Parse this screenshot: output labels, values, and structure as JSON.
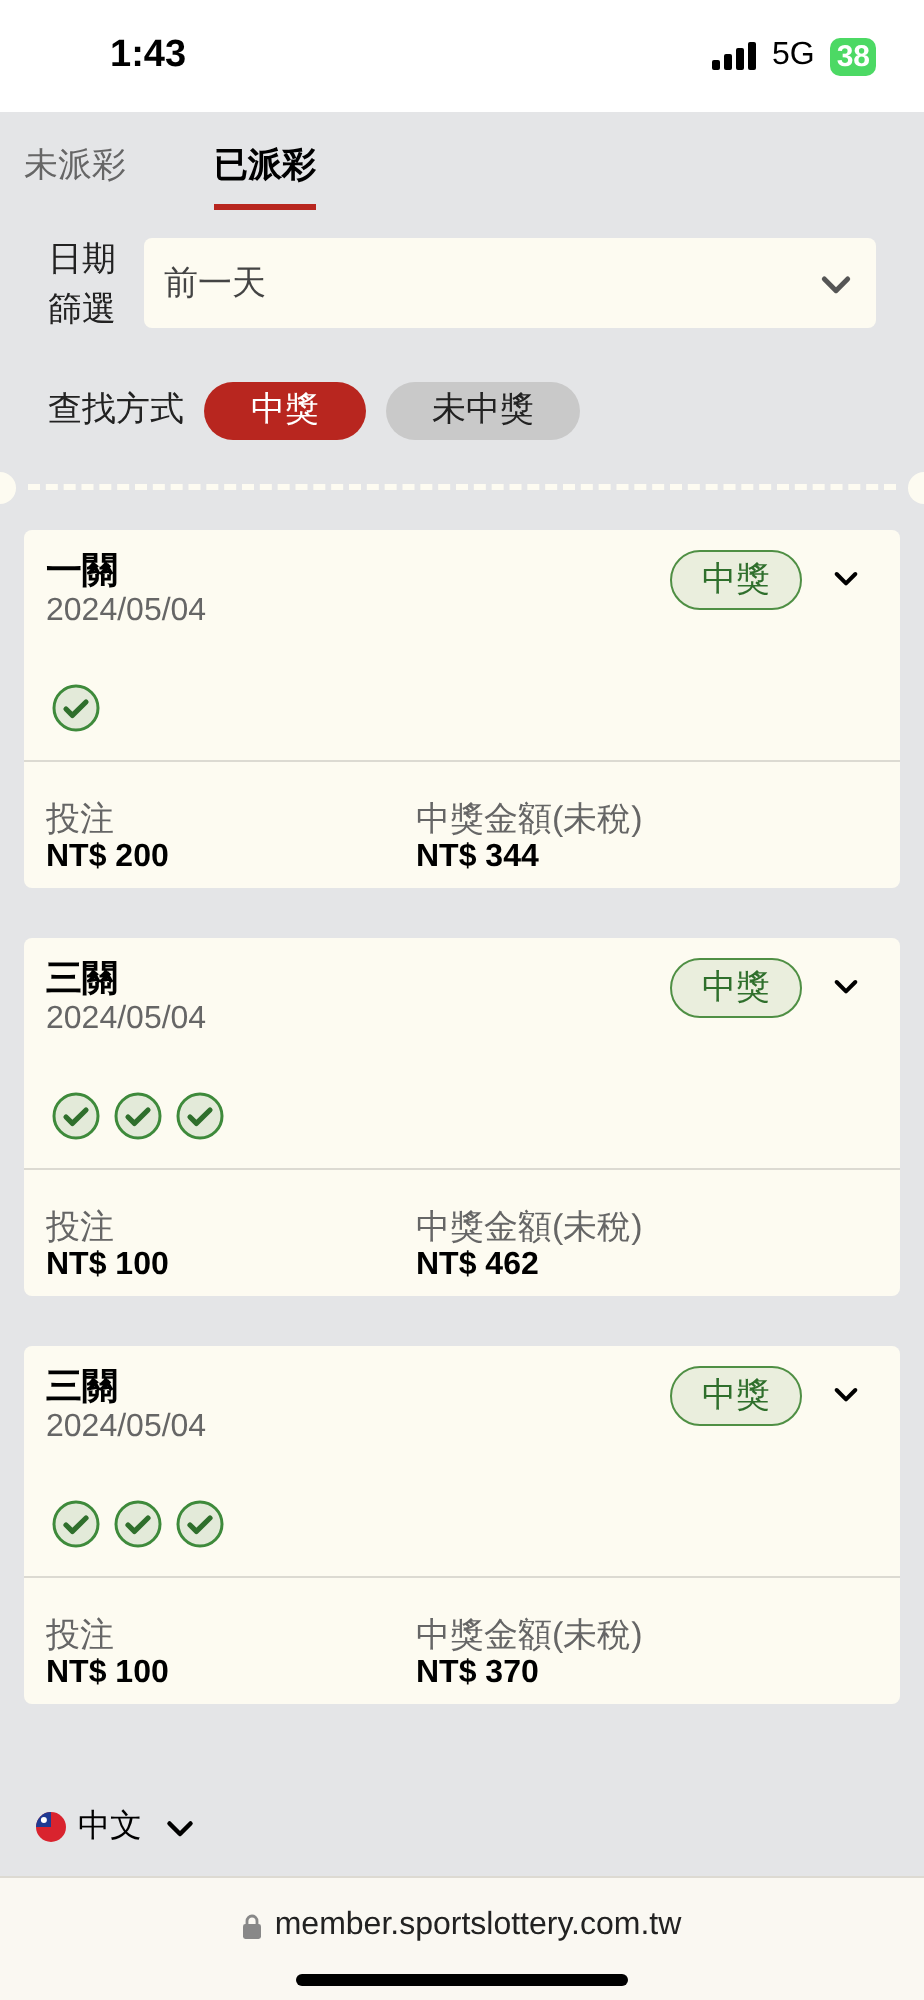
{
  "status_bar": {
    "time": "1:43",
    "network": "5G",
    "battery": "38"
  },
  "tabs": [
    {
      "label": "未派彩",
      "selected": false
    },
    {
      "label": "已派彩",
      "selected": true
    }
  ],
  "date_filter": {
    "label": "日期篩選",
    "value": "前一天"
  },
  "search_mode": {
    "label": "查找方式",
    "options": [
      {
        "label": "中獎",
        "selected": true
      },
      {
        "label": "未中獎",
        "selected": false
      }
    ]
  },
  "tickets": [
    {
      "title": "一關",
      "date": "2024/05/04",
      "status": "中獎",
      "legs": [
        {
          "won": true
        }
      ],
      "stake_label": "投注",
      "stake": "NT$ 200",
      "payout_label": "中獎金額(未稅)",
      "payout": "NT$ 344"
    },
    {
      "title": "三關",
      "date": "2024/05/04",
      "status": "中獎",
      "legs": [
        {
          "won": true
        },
        {
          "won": true
        },
        {
          "won": true
        }
      ],
      "stake_label": "投注",
      "stake": "NT$ 100",
      "payout_label": "中獎金額(未稅)",
      "payout": "NT$ 462"
    },
    {
      "title": "三關",
      "date": "2024/05/04",
      "status": "中獎",
      "legs": [
        {
          "won": true
        },
        {
          "won": true
        },
        {
          "won": true
        }
      ],
      "stake_label": "投注",
      "stake": "NT$ 100",
      "payout_label": "中獎金額(未稅)",
      "payout": "NT$ 370"
    }
  ],
  "footer": {
    "language": "中文"
  },
  "address_bar": {
    "url": "member.sportslottery.com.tw"
  }
}
